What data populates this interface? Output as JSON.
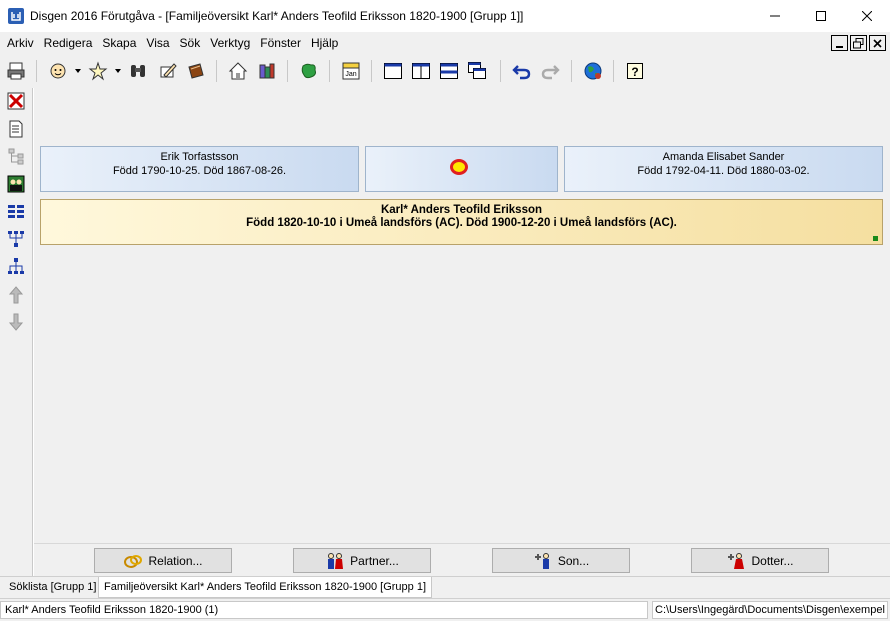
{
  "window": {
    "title": "Disgen 2016 Förutgåva - [Familjeöversikt Karl* Anders Teofild Eriksson 1820-1900 [Grupp 1]]",
    "minimize_glyph": "—",
    "maximize_glyph": "☐",
    "close_glyph": "✕"
  },
  "menu": [
    "Arkiv",
    "Redigera",
    "Skapa",
    "Visa",
    "Sök",
    "Verktyg",
    "Fönster",
    "Hjälp"
  ],
  "mdi_controls": {
    "minimize": "_",
    "restore": "❐",
    "close": "✕"
  },
  "toolbar_icons": [
    "printer-icon",
    "person-face-icon",
    "star-person-icon",
    "binoculars-icon",
    "hand-edit-icon",
    "book-icon",
    "home-icon",
    "books-icon",
    "map-icon",
    "calendar-icon",
    "layout-single-icon",
    "layout-columns-icon",
    "layout-rows-icon",
    "layout-cascade-icon",
    "undo-icon",
    "redo-icon",
    "globe-icon",
    "help-icon"
  ],
  "calendar_label": "Jan",
  "help_label": "?",
  "father": {
    "name": "Erik Torfastsson",
    "dates": "Född 1790-10-25. Död 1867-08-26."
  },
  "mother": {
    "name": "Amanda Elisabet Sander",
    "dates": "Född 1792-04-11. Död 1880-03-02."
  },
  "main_person": {
    "name": "Karl* Anders Teofild Eriksson",
    "dates": "Född 1820-10-10 i Umeå landsförs (AC). Död 1900-12-20 i Umeå landsförs (AC)."
  },
  "buttons": {
    "relation": "Relation...",
    "partner": "Partner...",
    "son": "Son...",
    "dotter": "Dotter..."
  },
  "tabs": [
    "Söklista [Grupp 1]",
    "Familjeöversikt Karl* Anders Teofild Eriksson 1820-1900 [Grupp 1]"
  ],
  "status": {
    "left": "Karl* Anders Teofild Eriksson 1820-1900 (1)",
    "right": "C:\\Users\\Ingegärd\\Documents\\Disgen\\exempel"
  },
  "colors": {
    "parent_box_left": "#eaf1fa",
    "parent_box_right": "#c9daf0",
    "main_box_left": "#fff8dc",
    "main_box_right": "#f5dfa0",
    "marriage_dot_fill": "#ffe800",
    "marriage_dot_ring": "#e02020"
  }
}
